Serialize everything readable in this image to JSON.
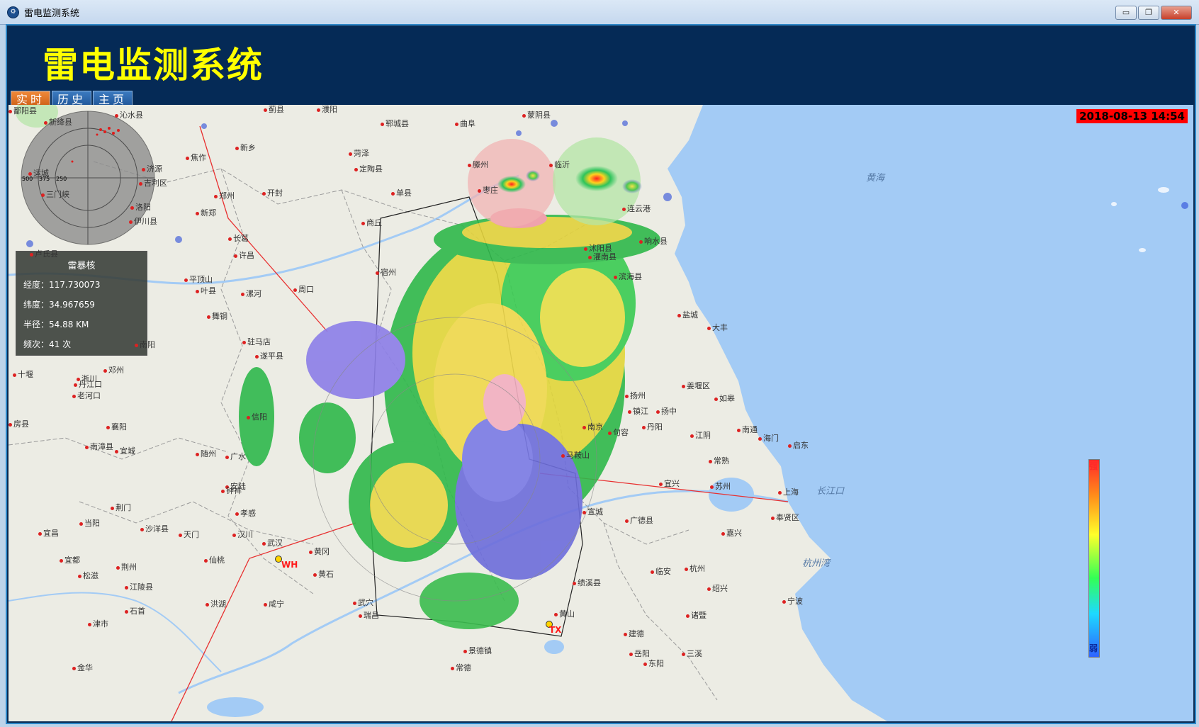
{
  "window": {
    "title": "雷电监测系统",
    "minimize": "▭",
    "restore": "❐",
    "close": "✕"
  },
  "header": {
    "title": "雷电监测系统"
  },
  "tabs": [
    {
      "label": "实时",
      "active": true
    },
    {
      "label": "历史",
      "active": false
    },
    {
      "label": "主页",
      "active": false
    }
  ],
  "timestamp": "2018-08-13 14:54",
  "info_panel": {
    "title": "雷暴核",
    "longitude": "经度：117.730073",
    "latitude": "纬度：34.967659",
    "radius": "半径：54.88  KM",
    "frequency": "频次：41  次"
  },
  "radar_scope": {
    "labels": [
      "500",
      "375",
      "250"
    ]
  },
  "legend": {
    "top": "强",
    "bottom": "弱"
  },
  "stations": [
    {
      "code": "WH"
    },
    {
      "code": "TX"
    }
  ],
  "seas": [
    "黄海",
    "长江口",
    "杭州湾"
  ],
  "cities": [
    "新绛县",
    "沁水县",
    "蓟县",
    "濮阳",
    "郓城县",
    "曲阜",
    "蒙阴县",
    "焦作",
    "新乡",
    "菏泽",
    "定陶县",
    "济源",
    "吉利区",
    "运城",
    "郑州",
    "开封",
    "单县",
    "三门峡",
    "洛阳",
    "新郑",
    "伊川县",
    "商丘",
    "滕州",
    "枣庄",
    "临沂",
    "连云港",
    "响水县",
    "长葛",
    "许昌",
    "卢氏县",
    "宿州",
    "沭阳县",
    "灌南县",
    "平顶山",
    "叶县",
    "漯河",
    "周口",
    "滨海县",
    "舞钢",
    "盐城",
    "大丰",
    "南阳",
    "驻马店",
    "遂平县",
    "十堰",
    "淅川",
    "丹江口",
    "邓州",
    "老河口",
    "扬州",
    "姜堰区",
    "如皋",
    "信阳",
    "镇江",
    "扬中",
    "南京",
    "房县",
    "襄阳",
    "句容",
    "丹阳",
    "江阴",
    "南通",
    "海门",
    "启东",
    "南漳县",
    "宜城",
    "随州",
    "广水",
    "马鞍山",
    "常熟",
    "宜兴",
    "苏州",
    "上海",
    "安陆",
    "钟祥",
    "宣城",
    "广德县",
    "奉贤区",
    "荆门",
    "孝感",
    "当阳",
    "天门",
    "汉川",
    "武汉",
    "黄冈",
    "嘉兴",
    "宜昌",
    "沙洋县",
    "宜都",
    "荆州",
    "仙桃",
    "黄石",
    "临安",
    "杭州",
    "松滋",
    "江陵县",
    "咸宁",
    "洪湖",
    "武穴",
    "绩溪县",
    "绍兴",
    "宁波",
    "石首",
    "黄山",
    "诸暨",
    "津市",
    "瑞昌",
    "景德镇",
    "建德",
    "岳阳",
    "三溪",
    "东阳",
    "金华",
    "常德",
    "鄱阳县"
  ]
}
